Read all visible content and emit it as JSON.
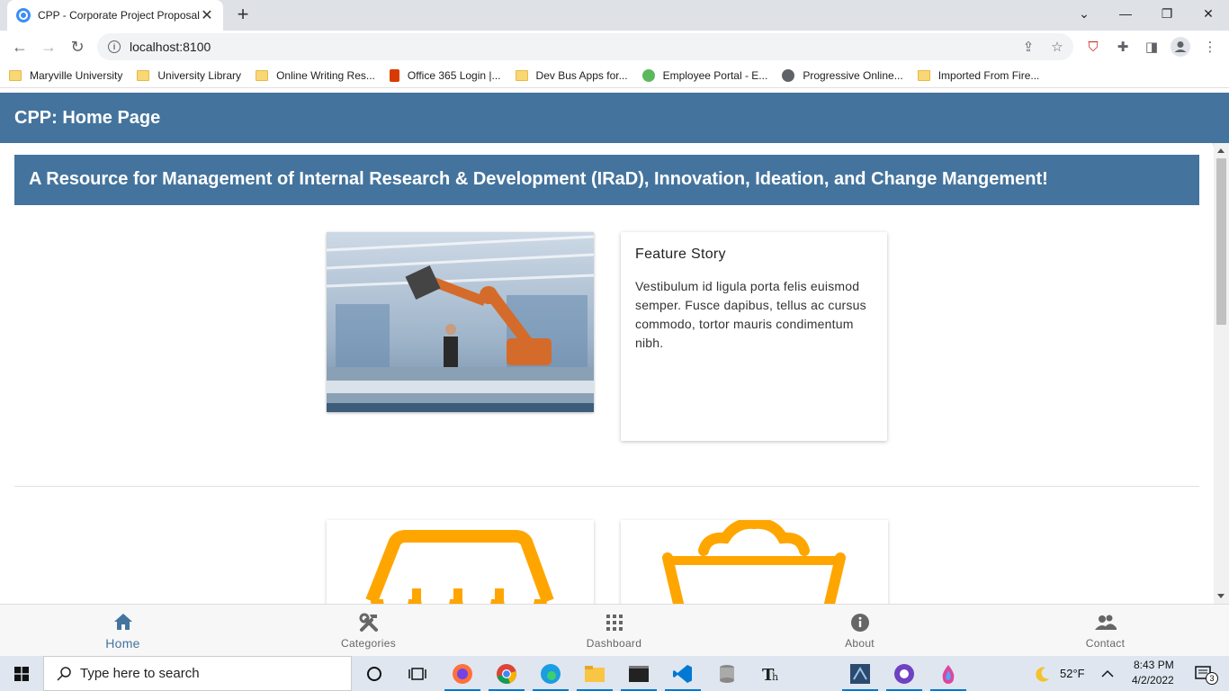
{
  "browser": {
    "tab_title": "CPP - Corporate Project Proposal",
    "url": "localhost:8100",
    "bookmarks": [
      {
        "label": "Maryville University",
        "icon": "folder-icon"
      },
      {
        "label": "University Library",
        "icon": "folder-icon"
      },
      {
        "label": "Online Writing Res...",
        "icon": "folder-icon"
      },
      {
        "label": "Office 365 Login |...",
        "icon": "office-icon"
      },
      {
        "label": "Dev Bus Apps for...",
        "icon": "folder-icon"
      },
      {
        "label": "Employee Portal - E...",
        "icon": "portal-icon"
      },
      {
        "label": "Progressive Online...",
        "icon": "globe-icon"
      },
      {
        "label": "Imported From Fire...",
        "icon": "folder-icon"
      }
    ]
  },
  "app": {
    "header_title": "CPP: Home Page",
    "banner_text": "A Resource for Management of Internal Research & Development (IRaD), Innovation, Ideation, and Change Mangement!",
    "feature": {
      "title": "Feature Story",
      "body": "Vestibulum id ligula porta felis euismod semper. Fusce dapibus, tellus ac cursus commodo, tortor mauris condimentum nibh."
    },
    "colors": {
      "primary": "#44749d",
      "accent": "#ffa500"
    },
    "tabs": [
      {
        "label": "Home",
        "icon": "home-icon",
        "active": true
      },
      {
        "label": "Categories",
        "icon": "tools-icon",
        "active": false
      },
      {
        "label": "Dashboard",
        "icon": "grid-icon",
        "active": false
      },
      {
        "label": "About",
        "icon": "info-icon",
        "active": false
      },
      {
        "label": "Contact",
        "icon": "people-icon",
        "active": false
      }
    ]
  },
  "taskbar": {
    "search_placeholder": "Type here to search",
    "weather": "52°F",
    "time": "8:43 PM",
    "date": "4/2/2022",
    "notifications": "3"
  }
}
